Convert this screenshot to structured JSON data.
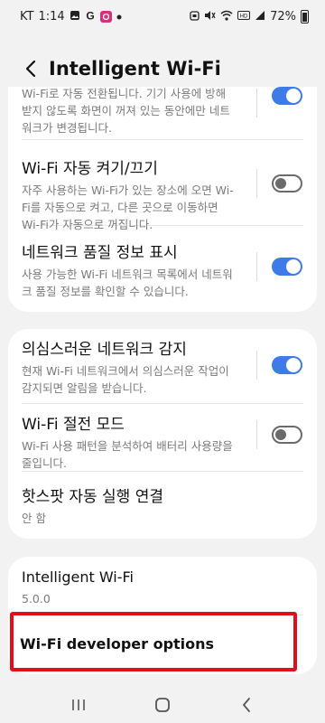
{
  "status_bar": {
    "carrier": "KT",
    "time": "1:14",
    "battery": "72%",
    "left_icons": [
      "image-icon",
      "g-icon",
      "app-icon",
      "dot-icon"
    ],
    "right_icons": [
      "alarm-icon",
      "mute-icon",
      "wifi-icon",
      "volte-icon",
      "signal-icon",
      "battery-icon"
    ]
  },
  "header": {
    "title": "Intelligent Wi-Fi"
  },
  "card1": {
    "partial_row": {
      "subtitle": "Wi-Fi로 자동 전환됩니다. 기기 사용에 방해받지 않도록 화면이 꺼져 있는 동안에만 네트워크가 변경됩니다.",
      "toggle_on": true
    },
    "rows": [
      {
        "title": "Wi-Fi 자동 켜기/끄기",
        "subtitle": "자주 사용하는 Wi-Fi가 있는 장소에 오면 Wi-Fi를 자동으로 켜고, 다른 곳으로 이동하면 Wi-Fi가 자동으로 꺼집니다.",
        "toggle_on": false
      },
      {
        "title": "네트워크 품질 정보 표시",
        "subtitle": "사용 가능한 Wi-Fi 네트워크 목록에서 네트워크 품질 정보를 확인할 수 있습니다.",
        "toggle_on": true
      }
    ]
  },
  "card2": {
    "rows": [
      {
        "title": "의심스러운 네트워크 감지",
        "subtitle": "현재 Wi-Fi 네트워크에서 의심스러운 작업이 감지되면 알림을 받습니다.",
        "toggle_on": true
      },
      {
        "title": "Wi-Fi 절전 모드",
        "subtitle": "Wi-Fi 사용 패턴을 분석하여 배터리 사용량을 줄입니다.",
        "toggle_on": false
      },
      {
        "title": "핫스팟 자동 실행 연결",
        "subtitle": "안 함"
      }
    ]
  },
  "card3": {
    "rows": [
      {
        "title": "Intelligent Wi-Fi",
        "subtitle": "5.0.0"
      },
      {
        "title": "Wi-Fi developer options"
      }
    ]
  },
  "colors": {
    "accent": "#3e7be8",
    "highlight": "#e0101b",
    "background": "#f2f2f2"
  },
  "navbar": {
    "icons": [
      "recent-apps-icon",
      "home-icon",
      "back-icon"
    ]
  }
}
